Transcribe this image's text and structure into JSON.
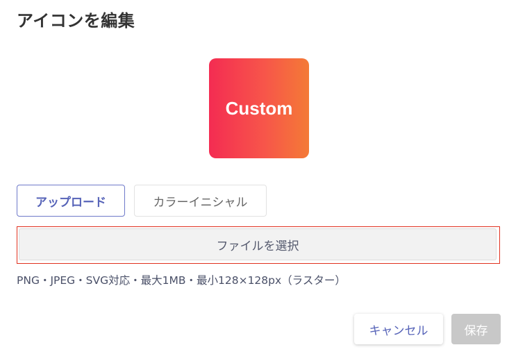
{
  "dialog": {
    "title": "アイコンを編集"
  },
  "preview": {
    "text": "Custom",
    "gradient_start": "#f42c52",
    "gradient_end": "#f47a36"
  },
  "tabs": [
    {
      "label": "アップロード",
      "active": true
    },
    {
      "label": "カラーイニシャル",
      "active": false
    }
  ],
  "upload": {
    "file_button_label": "ファイルを選択",
    "hint": "PNG・JPEG・SVG対応・最大1MB・最小128×128px（ラスター）"
  },
  "footer": {
    "cancel_label": "キャンセル",
    "save_label": "保存",
    "save_disabled": true
  },
  "colors": {
    "accent": "#5663b8",
    "highlight_outline": "#e0301e",
    "disabled": "#c8c8c8"
  }
}
